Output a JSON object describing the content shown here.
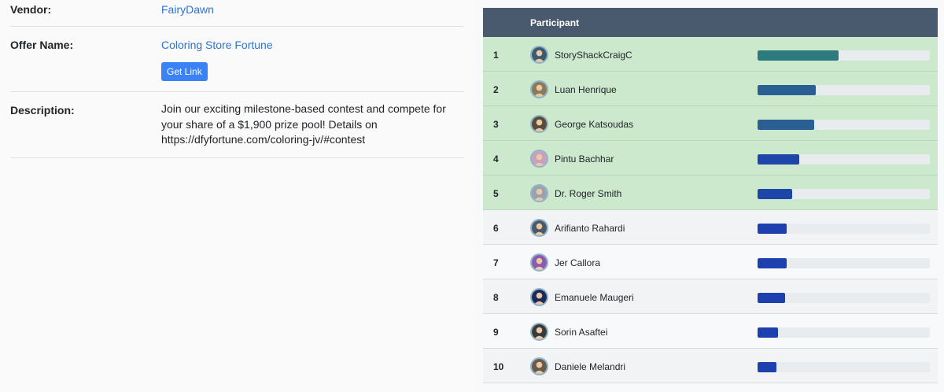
{
  "offer": {
    "vendor_label": "Vendor:",
    "vendor_value": "FairyDawn",
    "offer_name_label": "Offer Name:",
    "offer_name_value": "Coloring Store Fortune",
    "get_link_label": "Get Link",
    "description_label": "Description:",
    "description_value": "Join our exciting milestone-based contest and compete for your share of a $1,900 prize pool! Details on https://dfyfortune.com/coloring-jv/#contest"
  },
  "leaderboard": {
    "header_participant": "Participant",
    "rows": [
      {
        "rank": "1",
        "name": "StoryShackCraigC",
        "progress": 0.47,
        "bar_color": "#2e7b7f",
        "avatar_color": "#3d5a73",
        "highlight": true
      },
      {
        "rank": "2",
        "name": "Luan Henrique",
        "progress": 0.34,
        "bar_color": "#2a5f94",
        "avatar_color": "#8a7a5a",
        "highlight": true
      },
      {
        "rank": "3",
        "name": "George Katsoudas",
        "progress": 0.33,
        "bar_color": "#2a5f94",
        "avatar_color": "#5a4a3a",
        "highlight": true
      },
      {
        "rank": "4",
        "name": "Pintu Bachhar",
        "progress": 0.24,
        "bar_color": "#1e45a8",
        "avatar_color": "#c9a0c0",
        "highlight": true
      },
      {
        "rank": "5",
        "name": "Dr. Roger Smith",
        "progress": 0.2,
        "bar_color": "#1e45a8",
        "avatar_color": "#9aa3ad",
        "highlight": true
      },
      {
        "rank": "6",
        "name": "Arifianto Rahardi",
        "progress": 0.17,
        "bar_color": "#1e3fae",
        "avatar_color": "#4a5a6a",
        "highlight": false
      },
      {
        "rank": "7",
        "name": "Jer Callora",
        "progress": 0.17,
        "bar_color": "#1e3fae",
        "avatar_color": "#8a5ab0",
        "highlight": false
      },
      {
        "rank": "8",
        "name": "Emanuele Maugeri",
        "progress": 0.16,
        "bar_color": "#1e3fae",
        "avatar_color": "#1a2a5a",
        "highlight": false
      },
      {
        "rank": "9",
        "name": "Sorin Asaftei",
        "progress": 0.12,
        "bar_color": "#1e3fae",
        "avatar_color": "#3a3a3a",
        "highlight": false
      },
      {
        "rank": "10",
        "name": "Daniele Melandri",
        "progress": 0.11,
        "bar_color": "#1e3fae",
        "avatar_color": "#6a5a4a",
        "highlight": false
      }
    ]
  }
}
